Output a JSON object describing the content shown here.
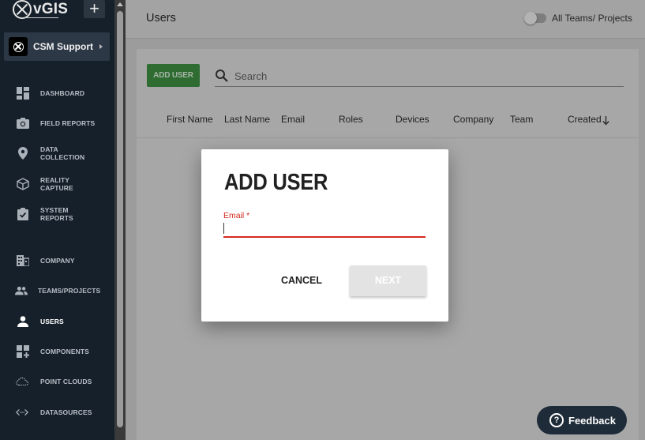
{
  "app": {
    "logo_text": "vGIS",
    "add_label": "+"
  },
  "org": {
    "name": "CSM Support"
  },
  "nav": [
    {
      "label": "DASHBOARD",
      "icon": "dashboard-icon"
    },
    {
      "label": "FIELD REPORTS",
      "icon": "camera-icon"
    },
    {
      "label": "DATA COLLECTION",
      "icon": "location-pin-icon"
    },
    {
      "label": "REALITY CAPTURE",
      "icon": "cube-icon"
    },
    {
      "label": "SYSTEM REPORTS",
      "icon": "clipboard-check-icon"
    },
    {
      "label": "COMPANY",
      "icon": "building-icon"
    },
    {
      "label": "TEAMS/PROJECTS",
      "icon": "people-icon"
    },
    {
      "label": "USERS",
      "icon": "person-icon"
    },
    {
      "label": "COMPONENTS",
      "icon": "widgets-add-icon"
    },
    {
      "label": "POINT CLOUDS",
      "icon": "cloud-icon"
    },
    {
      "label": "DATASOURCES",
      "icon": "code-arrows-icon"
    }
  ],
  "header": {
    "title": "Users",
    "toggle_label": "All Teams/ Projects",
    "toggle_on": false
  },
  "toolbar": {
    "add_user_label": "ADD USER",
    "search_placeholder": "Search"
  },
  "table": {
    "columns": [
      "First Name",
      "Last Name",
      "Email",
      "Roles",
      "Devices",
      "Company",
      "Team",
      "Created"
    ],
    "sort_column": "Created",
    "sort_direction": "descending"
  },
  "modal": {
    "title": "ADD USER",
    "email_label": "Email *",
    "email_value": "",
    "cancel_label": "CANCEL",
    "next_label": "NEXT"
  },
  "feedback": {
    "label": "Feedback",
    "icon_glyph": "?"
  },
  "colors": {
    "sidebar": "#16202a",
    "accent_green": "#2e6c31",
    "error_red": "#d62a1f",
    "feedback_bg": "#1e2b38"
  }
}
